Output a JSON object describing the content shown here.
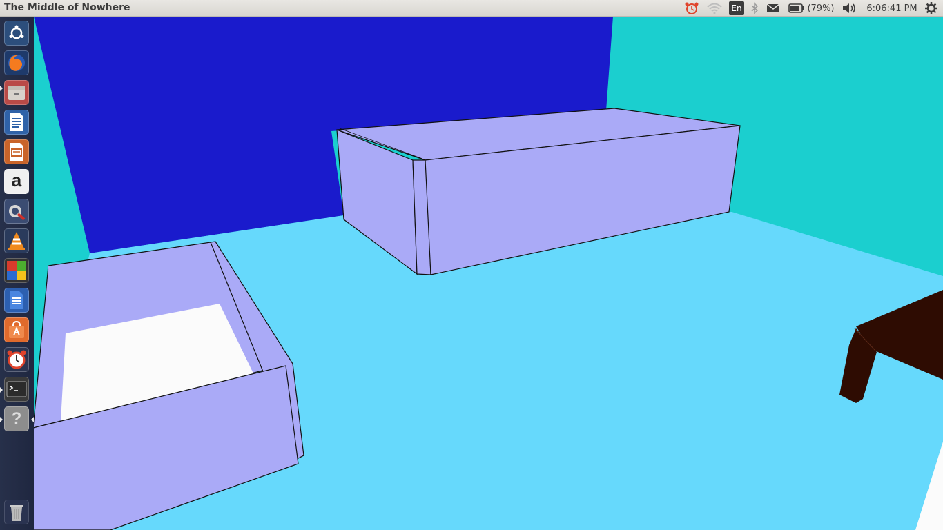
{
  "window": {
    "title": "The Middle of Nowhere"
  },
  "panel": {
    "keyboard_layout": "En",
    "battery_percent": "(79%)",
    "clock": "6:06:41 PM",
    "indicators": [
      "alarm-clock-icon",
      "wifi-icon",
      "keyboard-layout",
      "bluetooth-icon",
      "mail-icon",
      "battery-icon",
      "volume-icon",
      "session-gear-icon"
    ]
  },
  "launcher": {
    "items": [
      "ubuntu-dash",
      "firefox",
      "files",
      "libreoffice-writer",
      "libreoffice-impress",
      "amazon",
      "system-settings",
      "vlc",
      "multi-app",
      "document-viewer",
      "software-center",
      "alarm-clock",
      "terminal",
      "unknown-app",
      "trash"
    ]
  },
  "scene": {
    "colors": {
      "back_wall": "#1a1bcc",
      "side_wall": "#1bcfcf",
      "floor": "#66d9fc",
      "furniture": "#aaaaf7",
      "mattress": "#fbfbfb",
      "table": "#2e0c02"
    }
  }
}
